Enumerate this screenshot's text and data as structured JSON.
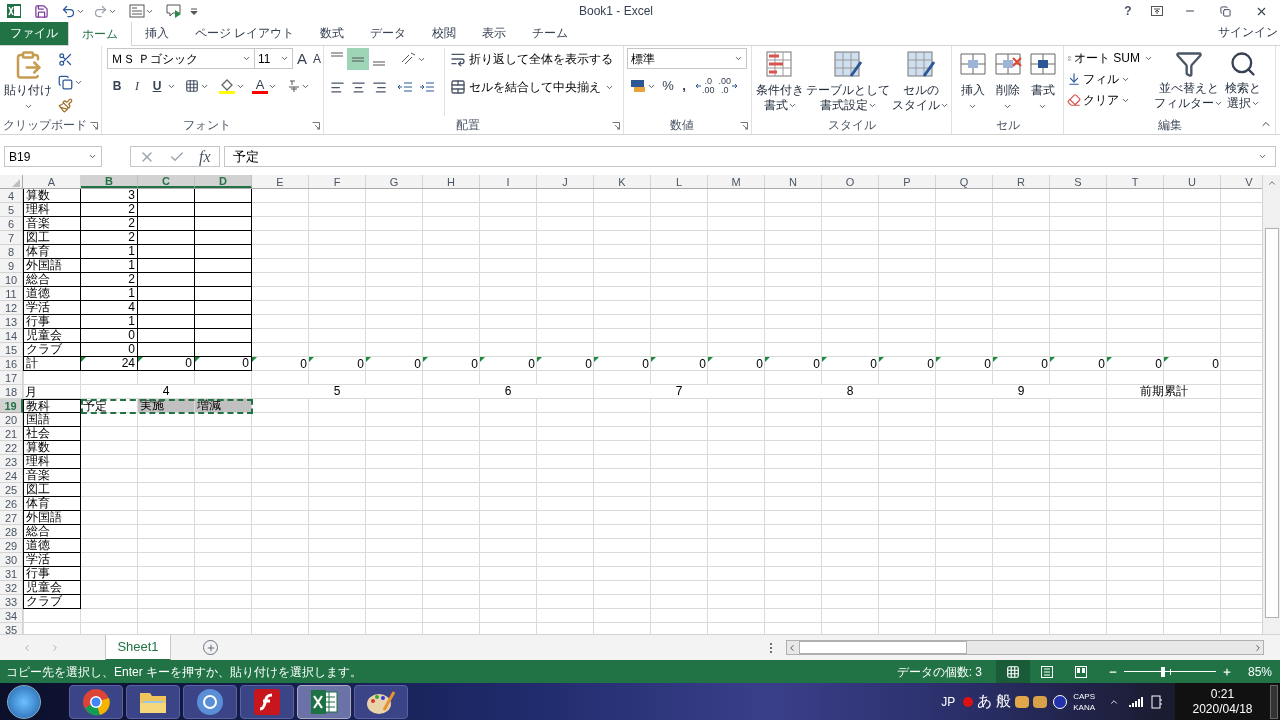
{
  "window": {
    "title": "Book1 - Excel",
    "help": "?"
  },
  "tabs": [
    {
      "label": "ファイル",
      "kind": "file",
      "selected": false
    },
    {
      "label": "ホーム",
      "kind": "tab",
      "selected": true
    },
    {
      "label": "挿入",
      "kind": "tab",
      "selected": false
    },
    {
      "label": "ページ レイアウト",
      "kind": "tab",
      "selected": false
    },
    {
      "label": "数式",
      "kind": "tab",
      "selected": false
    },
    {
      "label": "データ",
      "kind": "tab",
      "selected": false
    },
    {
      "label": "校閲",
      "kind": "tab",
      "selected": false
    },
    {
      "label": "表示",
      "kind": "tab",
      "selected": false
    },
    {
      "label": "チーム",
      "kind": "tab",
      "selected": false
    }
  ],
  "sign_in": "サインイン",
  "ribbon": {
    "clipboard": {
      "label": "クリップボード",
      "paste": "貼り付け"
    },
    "font": {
      "label": "フォント",
      "font_name": "ＭＳ Ｐゴシック",
      "font_size": "11",
      "grow": "A",
      "shrink": "A",
      "bold": "B",
      "italic": "I",
      "underline": "U",
      "font_color": "A"
    },
    "alignment": {
      "label": "配置",
      "wrap": "折り返して全体を表示する",
      "merge": "セルを結合して中央揃え",
      "middle_selected": true
    },
    "number": {
      "label": "数値",
      "format": "標準",
      "percent": "%",
      "comma": ",",
      "add_decimal": [
        ".0",
        ".00"
      ],
      "remove_decimal": [
        ".00",
        ".0"
      ]
    },
    "styles": {
      "label": "スタイル",
      "buttons": [
        [
          "条件付き",
          "書式"
        ],
        [
          "テーブルとして",
          "書式設定"
        ],
        [
          "セルの",
          "スタイル"
        ]
      ]
    },
    "cells": {
      "label": "セル",
      "buttons": [
        "挿入",
        "削除",
        "書式"
      ]
    },
    "editing": {
      "label": "編集",
      "autosum": "オート SUM",
      "fill": "フィル",
      "clear": "クリア",
      "sort": [
        "並べ替えと",
        "フィルター"
      ],
      "find": [
        "検索と",
        "選択"
      ]
    }
  },
  "formula_bar": {
    "name_box": "B19",
    "fx": "fx",
    "value": "予定"
  },
  "grid": {
    "columns": [
      {
        "label": "A",
        "selected": false
      },
      {
        "label": "B",
        "selected": true
      },
      {
        "label": "C",
        "selected": true
      },
      {
        "label": "D",
        "selected": true
      },
      {
        "label": "E",
        "selected": false
      },
      {
        "label": "F",
        "selected": false
      },
      {
        "label": "G",
        "selected": false
      },
      {
        "label": "H",
        "selected": false
      },
      {
        "label": "I",
        "selected": false
      },
      {
        "label": "J",
        "selected": false
      },
      {
        "label": "K",
        "selected": false
      },
      {
        "label": "L",
        "selected": false
      },
      {
        "label": "M",
        "selected": false
      },
      {
        "label": "N",
        "selected": false
      },
      {
        "label": "O",
        "selected": false
      },
      {
        "label": "P",
        "selected": false
      },
      {
        "label": "Q",
        "selected": false
      },
      {
        "label": "R",
        "selected": false
      },
      {
        "label": "S",
        "selected": false
      },
      {
        "label": "T",
        "selected": false
      },
      {
        "label": "U",
        "selected": false
      },
      {
        "label": "V",
        "selected": false
      }
    ],
    "rows": [
      {
        "number": "4",
        "selected": false,
        "cells": [
          {
            "text": "算数",
            "bordered": true
          },
          {
            "text": "3",
            "bordered": true
          },
          {
            "bordered": true
          },
          {
            "bordered": true
          }
        ]
      },
      {
        "number": "5",
        "selected": false,
        "cells": [
          {
            "text": "理科",
            "bordered": true
          },
          {
            "text": "2",
            "bordered": true
          },
          {
            "bordered": true
          },
          {
            "bordered": true
          }
        ]
      },
      {
        "number": "6",
        "selected": false,
        "cells": [
          {
            "text": "音楽",
            "bordered": true
          },
          {
            "text": "2",
            "bordered": true
          },
          {
            "bordered": true
          },
          {
            "bordered": true
          }
        ]
      },
      {
        "number": "7",
        "selected": false,
        "cells": [
          {
            "text": "図工",
            "bordered": true
          },
          {
            "text": "2",
            "bordered": true
          },
          {
            "bordered": true
          },
          {
            "bordered": true
          }
        ]
      },
      {
        "number": "8",
        "selected": false,
        "cells": [
          {
            "text": "体育",
            "bordered": true
          },
          {
            "text": "1",
            "bordered": true
          },
          {
            "bordered": true
          },
          {
            "bordered": true
          }
        ]
      },
      {
        "number": "9",
        "selected": false,
        "cells": [
          {
            "text": "外国語",
            "bordered": true
          },
          {
            "text": "1",
            "bordered": true
          },
          {
            "bordered": true
          },
          {
            "bordered": true
          }
        ]
      },
      {
        "number": "10",
        "selected": false,
        "cells": [
          {
            "text": "総合",
            "bordered": true
          },
          {
            "text": "2",
            "bordered": true
          },
          {
            "bordered": true
          },
          {
            "bordered": true
          }
        ]
      },
      {
        "number": "11",
        "selected": false,
        "cells": [
          {
            "text": "道徳",
            "bordered": true
          },
          {
            "text": "1",
            "bordered": true
          },
          {
            "bordered": true
          },
          {
            "bordered": true
          }
        ]
      },
      {
        "number": "12",
        "selected": false,
        "cells": [
          {
            "text": "学活",
            "bordered": true
          },
          {
            "text": "4",
            "bordered": true
          },
          {
            "bordered": true
          },
          {
            "bordered": true
          }
        ]
      },
      {
        "number": "13",
        "selected": false,
        "cells": [
          {
            "text": "行事",
            "bordered": true
          },
          {
            "text": "1",
            "bordered": true
          },
          {
            "bordered": true
          },
          {
            "bordered": true
          }
        ]
      },
      {
        "number": "14",
        "selected": false,
        "cells": [
          {
            "text": "児童会",
            "bordered": true
          },
          {
            "text": "0",
            "bordered": true
          },
          {
            "bordered": true
          },
          {
            "bordered": true
          }
        ]
      },
      {
        "number": "15",
        "selected": false,
        "cells": [
          {
            "text": "クラブ",
            "bordered": true
          },
          {
            "text": "0",
            "bordered": true
          },
          {
            "bordered": true
          },
          {
            "bordered": true
          }
        ]
      },
      {
        "number": "16",
        "selected": false,
        "cells": [
          {
            "text": "計",
            "bordered": true,
            "flagged": false
          },
          {
            "text": "24",
            "bordered": true,
            "flagged": true
          },
          {
            "text": "0",
            "bordered": true,
            "flagged": true
          },
          {
            "text": "0",
            "bordered": true,
            "flagged": true
          },
          {
            "text": "0",
            "bordered": false,
            "flagged": true
          },
          {
            "text": "0",
            "bordered": false,
            "flagged": true
          },
          {
            "text": "0",
            "bordered": false,
            "flagged": true
          },
          {
            "text": "0",
            "bordered": false,
            "flagged": true
          },
          {
            "text": "0",
            "bordered": false,
            "flagged": true
          },
          {
            "text": "0",
            "bordered": false,
            "flagged": true
          },
          {
            "text": "0",
            "bordered": false,
            "flagged": true
          },
          {
            "text": "0",
            "bordered": false,
            "flagged": true
          },
          {
            "text": "0",
            "bordered": false,
            "flagged": true
          },
          {
            "text": "0",
            "bordered": false,
            "flagged": true
          },
          {
            "text": "0",
            "bordered": false,
            "flagged": true
          },
          {
            "text": "0",
            "bordered": false,
            "flagged": true
          },
          {
            "text": "0",
            "bordered": false,
            "flagged": true
          },
          {
            "text": "0",
            "bordered": false,
            "flagged": true
          },
          {
            "text": "0",
            "bordered": false,
            "flagged": true
          },
          {
            "text": "0",
            "bordered": false,
            "flagged": true
          },
          {
            "text": "0",
            "bordered": false,
            "flagged": true
          }
        ]
      },
      {
        "number": "17",
        "selected": false,
        "cells": []
      },
      {
        "number": "18",
        "selected": false,
        "cells": [
          {
            "text": "月",
            "bordered": false
          },
          {
            "text": "4",
            "bordered": false,
            "merged": true
          },
          {
            "covered": true
          },
          {
            "covered": true
          },
          {
            "text": "5",
            "bordered": false,
            "merged": true
          },
          {
            "covered": true
          },
          {
            "covered": true
          },
          {
            "text": "6",
            "bordered": false,
            "merged": true
          },
          {
            "covered": true
          },
          {
            "covered": true
          },
          {
            "text": "7",
            "bordered": false,
            "merged": true
          },
          {
            "covered": true
          },
          {
            "covered": true
          },
          {
            "text": "8",
            "bordered": false,
            "merged": true
          },
          {
            "covered": true
          },
          {
            "covered": true
          },
          {
            "text": "9",
            "bordered": false,
            "merged": true
          },
          {
            "covered": true
          },
          {
            "covered": true
          },
          {
            "text": "前期累計",
            "bordered": false,
            "merged": true
          },
          {
            "covered": true
          }
        ]
      },
      {
        "number": "19",
        "selected": true,
        "cells": [
          {
            "text": "教科",
            "bordered": true,
            "copied": false
          },
          {
            "text": "予定",
            "bordered": false,
            "copied": true
          },
          {
            "text": "実施",
            "bordered": false,
            "copied": true,
            "color": "#c0c0c0"
          },
          {
            "text": "増減",
            "bordered": false,
            "copied": true,
            "color": "#c0c0c0"
          }
        ]
      },
      {
        "number": "20",
        "selected": false,
        "cells": [
          {
            "text": "国語",
            "bordered": true
          }
        ]
      },
      {
        "number": "21",
        "selected": false,
        "cells": [
          {
            "text": "社会",
            "bordered": true
          }
        ]
      },
      {
        "number": "22",
        "selected": false,
        "cells": [
          {
            "text": "算数",
            "bordered": true
          }
        ]
      },
      {
        "number": "23",
        "selected": false,
        "cells": [
          {
            "text": "理科",
            "bordered": true
          }
        ]
      },
      {
        "number": "24",
        "selected": false,
        "cells": [
          {
            "text": "音楽",
            "bordered": true
          }
        ]
      },
      {
        "number": "25",
        "selected": false,
        "cells": [
          {
            "text": "図工",
            "bordered": true
          }
        ]
      },
      {
        "number": "26",
        "selected": false,
        "cells": [
          {
            "text": "体育",
            "bordered": true
          }
        ]
      },
      {
        "number": "27",
        "selected": false,
        "cells": [
          {
            "text": "外国語",
            "bordered": true
          }
        ]
      },
      {
        "number": "28",
        "selected": false,
        "cells": [
          {
            "text": "総合",
            "bordered": true
          }
        ]
      },
      {
        "number": "29",
        "selected": false,
        "cells": [
          {
            "text": "道徳",
            "bordered": true
          }
        ]
      },
      {
        "number": "30",
        "selected": false,
        "cells": [
          {
            "text": "学活",
            "bordered": true
          }
        ]
      },
      {
        "number": "31",
        "selected": false,
        "cells": [
          {
            "text": "行事",
            "bordered": true
          }
        ]
      },
      {
        "number": "32",
        "selected": false,
        "cells": [
          {
            "text": "児童会",
            "bordered": true
          }
        ]
      },
      {
        "number": "33",
        "selected": false,
        "cells": [
          {
            "text": "クラブ",
            "bordered": true
          }
        ]
      },
      {
        "number": "34",
        "selected": false,
        "cells": []
      },
      {
        "number": "35",
        "selected": false,
        "cells": []
      }
    ]
  },
  "sheets": [
    {
      "label": "Sheet1",
      "selected": true
    }
  ],
  "status_bar": {
    "message": "コピー先を選択し、Enter キーを押すか、貼り付けを選択します。",
    "count": "データの個数: 3",
    "views": [
      {
        "kind": "normal",
        "selected": true
      },
      {
        "kind": "layout",
        "selected": false
      },
      {
        "kind": "pagebreak",
        "selected": false
      }
    ],
    "zoom": {
      "level": 0.42,
      "reading": "85%"
    }
  },
  "taskbar": {
    "apps": [
      {
        "kind": "browser",
        "selected": false
      },
      {
        "kind": "files",
        "selected": false
      },
      {
        "kind": "globe",
        "selected": false
      },
      {
        "kind": "flash",
        "selected": false
      },
      {
        "kind": "sheet",
        "selected": true
      },
      {
        "kind": "palette",
        "selected": false
      }
    ],
    "language": "JP",
    "ime_mode": "あ",
    "ime_dict": "般",
    "caps": "CAPS",
    "kana": "KANA",
    "time": "0:21",
    "date": "2020/04/18"
  }
}
